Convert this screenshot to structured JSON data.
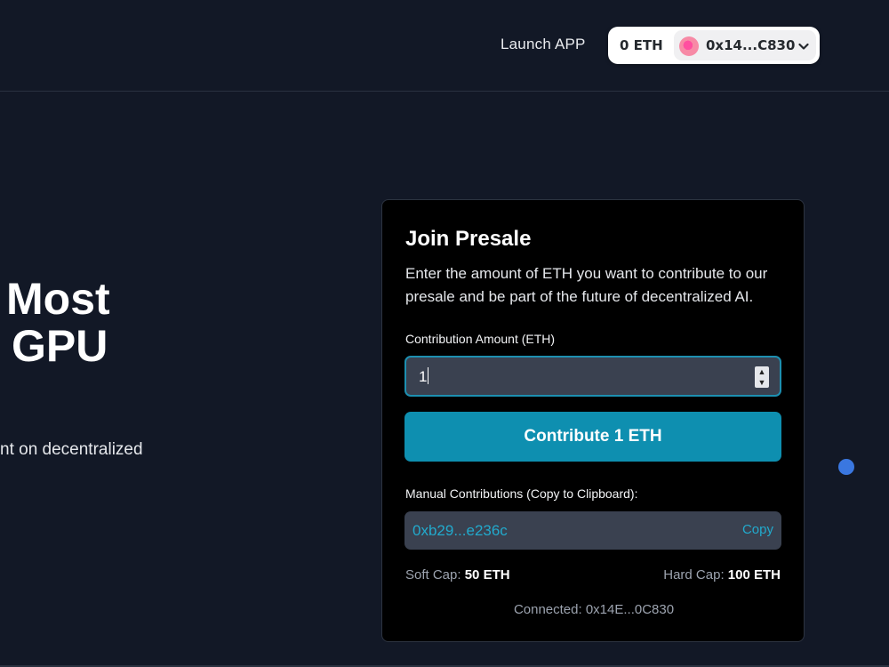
{
  "header": {
    "launch_label": "Launch APP",
    "wallet": {
      "balance": "0 ETH",
      "address": "0x14...C830",
      "chevron": "❯"
    }
  },
  "hero": {
    "line1": "Most",
    "line2": "GPU",
    "subtitle": "nt on decentralized"
  },
  "presale": {
    "title": "Join Presale",
    "description": "Enter the amount of ETH you want to contribute to our presale and be part of the future of decentralized AI.",
    "amount_label": "Contribution Amount (ETH)",
    "amount_value": "1",
    "contribute_label": "Contribute 1 ETH",
    "manual_label": "Manual Contributions (Copy to Clipboard):",
    "deposit_address": "0xb29...e236c",
    "copy_label": "Copy",
    "soft_cap_label": "Soft Cap:",
    "soft_cap_value": "50 ETH",
    "hard_cap_label": "Hard Cap:",
    "hard_cap_value": "100 ETH",
    "connected_text": "Connected: 0x14E...0C830"
  },
  "colors": {
    "background": "#121826",
    "accent": "#0e8fb0",
    "link": "#22aacd",
    "card": "#000000"
  },
  "icons": {
    "avatar": "avatar-icon",
    "chevron": "chevron-down-icon",
    "spinner_up": "spinner-up-icon",
    "spinner_down": "spinner-down-icon",
    "floating_dot": "status-dot-icon"
  }
}
